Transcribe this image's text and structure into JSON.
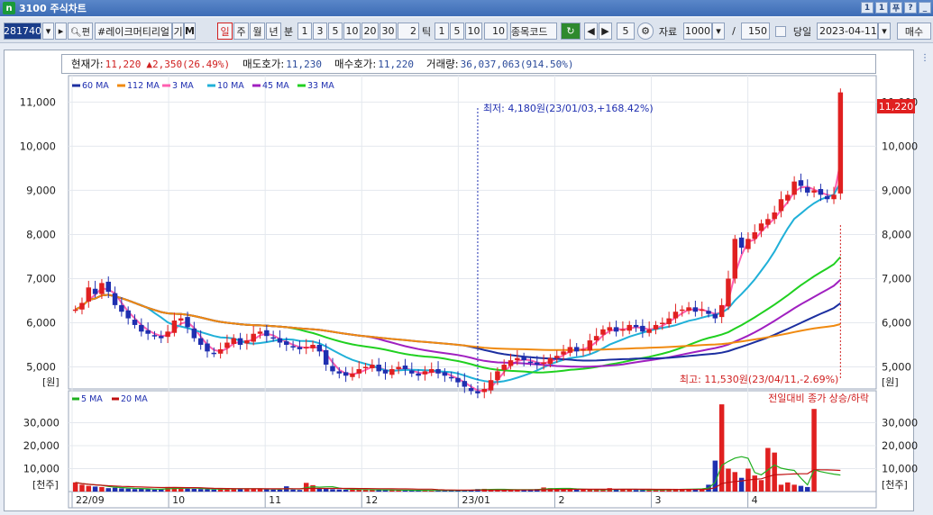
{
  "window": {
    "title": "3100 주식차트",
    "buttons": [
      "1",
      "1",
      "푸",
      "?",
      "_"
    ]
  },
  "toolbar": {
    "code": "281740",
    "name": "#레이크머티리얼",
    "name_btn1": "기",
    "name_btn2": "M",
    "periods": [
      "일",
      "주",
      "월",
      "년"
    ],
    "selected_period": "일",
    "min_label": "분",
    "min_options": [
      "1",
      "3",
      "5",
      "10",
      "20",
      "30"
    ],
    "min_input": "2",
    "tick_label": "틱",
    "tick_options": [
      "1",
      "5",
      "10"
    ],
    "tick_input": "10",
    "code_field": "종목코드",
    "step_value": "5",
    "data_label": "자료",
    "data_count": "1000",
    "slash": "/",
    "page_size": "150",
    "today_label": "당일",
    "date": "2023-04-11",
    "order_btn": "매수"
  },
  "info": {
    "price_label": "현재가:",
    "price": "11,220",
    "change": "▲2,350(26.49%)",
    "ask_label": "매도호가:",
    "ask": "11,230",
    "bid_label": "매수호가:",
    "bid": "11,220",
    "volume_label": "거래량:",
    "volume": "36,037,063(914.50%)"
  },
  "colors": {
    "up": "#e02020",
    "down": "#1f2fb0",
    "ma60": "#1c2fa0",
    "ma112": "#f08a10",
    "ma3": "#ff5fb0",
    "ma10": "#20b0d8",
    "ma45": "#a020c0",
    "ma33": "#20d020",
    "vma5": "#20b020",
    "vma20": "#c01010"
  },
  "price_legend": [
    "60 MA",
    "112 MA",
    "3 MA",
    "10 MA",
    "45 MA",
    "33 MA"
  ],
  "volume_legend": [
    "5 MA",
    "20 MA"
  ],
  "annotations": {
    "low": "최저: 4,180원(23/01/03,+168.42%)",
    "high": "최고: 11,530원(23/04/11,-2.69%)",
    "vol_note": "전일대비 종가 상승/하락",
    "last_price_tag": "11,220"
  },
  "axes": {
    "price_unit": "[원]",
    "volume_unit": "[천주]",
    "x_ticks": [
      "22/09",
      "10",
      "11",
      "12",
      "23/01",
      "2",
      "3",
      "4"
    ]
  },
  "chart_data": {
    "type": "candlestick",
    "price_ticks": [
      5000,
      6000,
      7000,
      8000,
      9000,
      10000,
      11000
    ],
    "price_tick_labels": [
      "5,000",
      "6,000",
      "7,000",
      "8,000",
      "9,000",
      "10,000",
      "11,000"
    ],
    "ylim_price": [
      4500,
      11600
    ],
    "volume_ticks": [
      10000,
      20000,
      30000
    ],
    "volume_tick_labels": [
      "10,000",
      "20,000",
      "30,000"
    ],
    "ylim_volume": [
      0,
      40000
    ],
    "closes": [
      6300,
      6450,
      6800,
      6650,
      6900,
      6700,
      6400,
      6250,
      6100,
      5950,
      5800,
      5750,
      5700,
      5650,
      5800,
      6050,
      6100,
      5900,
      5650,
      5500,
      5350,
      5300,
      5400,
      5550,
      5650,
      5500,
      5600,
      5750,
      5800,
      5700,
      5650,
      5550,
      5500,
      5450,
      5400,
      5450,
      5500,
      5350,
      5050,
      4900,
      4850,
      4800,
      4850,
      4950,
      5000,
      5050,
      4900,
      4850,
      4950,
      5000,
      4950,
      4850,
      4800,
      4900,
      4950,
      4850,
      4800,
      4750,
      4650,
      4550,
      4450,
      4400,
      4500,
      4700,
      4900,
      5050,
      5150,
      5200,
      5150,
      5100,
      5050,
      5100,
      5200,
      5250,
      5350,
      5450,
      5350,
      5400,
      5600,
      5700,
      5850,
      5900,
      5800,
      5850,
      5950,
      5900,
      5800,
      5850,
      5950,
      6000,
      6100,
      6250,
      6300,
      6350,
      6250,
      6300,
      6200,
      6100,
      6400,
      7000,
      7900,
      7700,
      7900,
      8050,
      8250,
      8350,
      8500,
      8800,
      8900,
      9200,
      9100,
      8950,
      9000,
      8900,
      8800,
      8900,
      11220
    ],
    "volumes": [
      4000,
      3000,
      2500,
      2200,
      2000,
      1500,
      1700,
      1400,
      1300,
      1100,
      1200,
      1000,
      900,
      950,
      2000,
      1800,
      1500,
      1300,
      1200,
      1100,
      1000,
      900,
      1100,
      1500,
      1300,
      1200,
      1100,
      1000,
      1400,
      1000,
      900,
      800,
      2300,
      900,
      700,
      3800,
      2800,
      1500,
      1500,
      1000,
      900,
      800,
      900,
      1000,
      800,
      700,
      600,
      650,
      700,
      600,
      500,
      450,
      500,
      600,
      550,
      500,
      450,
      500,
      600,
      650,
      800,
      1100,
      1200,
      1000,
      900,
      800,
      700,
      750,
      900,
      1000,
      1100,
      1800,
      1500,
      1300,
      1200,
      1000,
      900,
      850,
      800,
      750,
      700,
      1500,
      1000,
      900,
      800,
      700,
      650,
      700,
      800,
      900,
      1000,
      1200,
      1100,
      1000,
      1200,
      1300,
      3000,
      13500,
      38000,
      10000,
      8500,
      6000,
      10000,
      7000,
      5000,
      19000,
      17000,
      3000,
      4000,
      3000,
      2500,
      2000,
      36000,
      0,
      0,
      0,
      0
    ],
    "moving_average_labels": [
      "60 MA",
      "112 MA",
      "3 MA",
      "10 MA",
      "45 MA",
      "33 MA"
    ]
  }
}
